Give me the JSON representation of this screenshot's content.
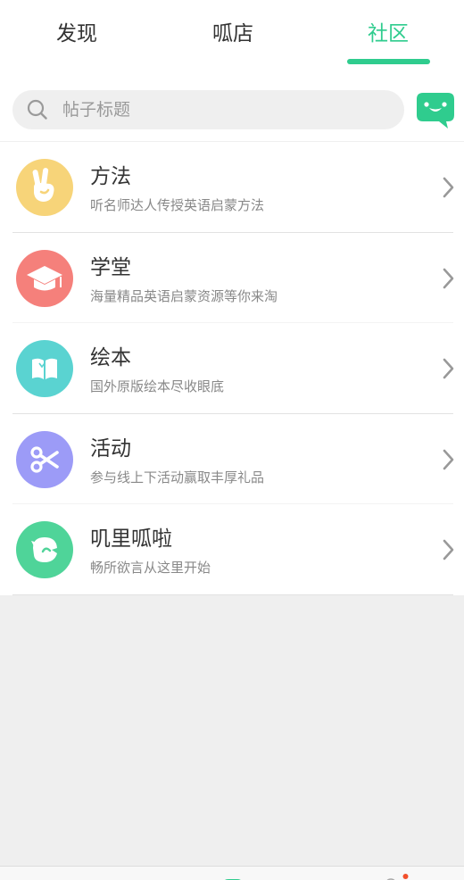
{
  "tabs": [
    {
      "label": "发现",
      "active": false
    },
    {
      "label": "呱店",
      "active": false
    },
    {
      "label": "社区",
      "active": true
    }
  ],
  "search": {
    "placeholder": "帖子标题",
    "value": ""
  },
  "colors": {
    "accent": "#2fcc8e",
    "method": "#f7d479",
    "school": "#f5807b",
    "picturebook": "#5ad3d1",
    "activity": "#9c9bf7",
    "chat": "#4fd499"
  },
  "menu": {
    "items": [
      {
        "title": "方法",
        "subtitle": "听名师达人传授英语启蒙方法",
        "icon": "victory-hand-icon"
      },
      {
        "title": "学堂",
        "subtitle": "海量精品英语启蒙资源等你来淘",
        "icon": "graduation-cap-icon"
      },
      {
        "title": "绘本",
        "subtitle": "国外原版绘本尽收眼底",
        "icon": "open-book-icon"
      },
      {
        "title": "活动",
        "subtitle": "参与线上下活动赢取丰厚礼品",
        "icon": "scissors-icon"
      },
      {
        "title": "叽里呱啦",
        "subtitle": "畅所欲言从这里开始",
        "icon": "chat-bird-icon"
      }
    ]
  }
}
